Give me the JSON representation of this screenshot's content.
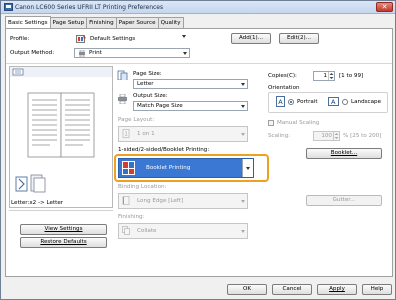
{
  "window": {
    "title": "Canon LC600 Series UFRII LT Printing Preferences"
  },
  "tabs": [
    "Basic Settings",
    "Page Setup",
    "Finishing",
    "Paper Source",
    "Quality"
  ],
  "profile": {
    "label": "Profile:",
    "value": "Default Settings",
    "add_button": "Add(1)...",
    "edit_button": "Edit(2)..."
  },
  "output_method": {
    "label": "Output Method:",
    "value": "Print"
  },
  "preview": {
    "caption": "Letter:x2 -> Letter"
  },
  "left_buttons": {
    "view_settings": "View Settings",
    "restore_defaults": "Restore Defaults"
  },
  "page_size": {
    "label": "Page Size:",
    "value": "Letter"
  },
  "output_size": {
    "label": "Output Size:",
    "value": "Match Page Size"
  },
  "page_layout": {
    "label": "Page Layout:",
    "value": "1 on 1"
  },
  "printing_type": {
    "label": "1-sided/2-sided/Booklet Printing:",
    "value": "Booklet Printing"
  },
  "binding_location": {
    "label": "Binding Location:",
    "value": "Long Edge [Left]"
  },
  "finishing": {
    "label": "Finishing:",
    "value": "Collate"
  },
  "copies": {
    "label": "Copies(C):",
    "value": "1",
    "range": "[1 to 99]"
  },
  "orientation": {
    "label": "Orientation",
    "portrait": "Portrait",
    "landscape": "Landscape"
  },
  "manual_scaling": {
    "label": "Manual Scaling"
  },
  "scaling": {
    "label": "Scaling:",
    "value": "100",
    "range": "% [25 to 200]"
  },
  "booklet_button": "Booklet...",
  "gutter_button": "Gutter...",
  "footer": {
    "ok": "OK",
    "cancel": "Cancel",
    "apply": "Apply",
    "help": "Help"
  },
  "colors": {
    "highlight": "#f0a020",
    "selection": "#3a78d4"
  }
}
